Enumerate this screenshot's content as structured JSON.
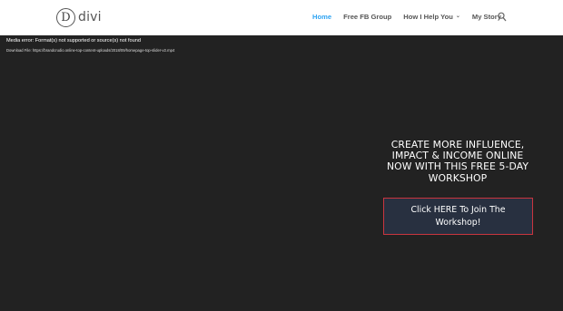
{
  "logo": {
    "mark": "D",
    "text": "divi"
  },
  "nav": {
    "items": [
      {
        "label": "Home",
        "active": true,
        "dropdown": false
      },
      {
        "label": "Free FB Group",
        "active": false,
        "dropdown": false
      },
      {
        "label": "How I Help You",
        "active": false,
        "dropdown": true
      },
      {
        "label": "My Story",
        "active": false,
        "dropdown": false
      }
    ],
    "dropdown_glyph": "⌄",
    "search_icon": "search-icon"
  },
  "hero": {
    "media_error": "Media error: Format(s) not supported or source(s) not found",
    "download_line": "Download File: https://brandcrudio.online-top-content-uploads/2018/09/homepage-top-slider-v2.mp4"
  },
  "cta": {
    "heading": "CREATE MORE INFLUENCE, IMPACT & INCOME ONLINE NOW WITH THIS FREE 5-DAY WORKSHOP",
    "button_label": "Click HERE To Join The Workshop!"
  },
  "colors": {
    "accent": "#2ea3f2",
    "hero_bg": "#222222",
    "button_bg": "#283040",
    "button_border": "#c9353f"
  }
}
